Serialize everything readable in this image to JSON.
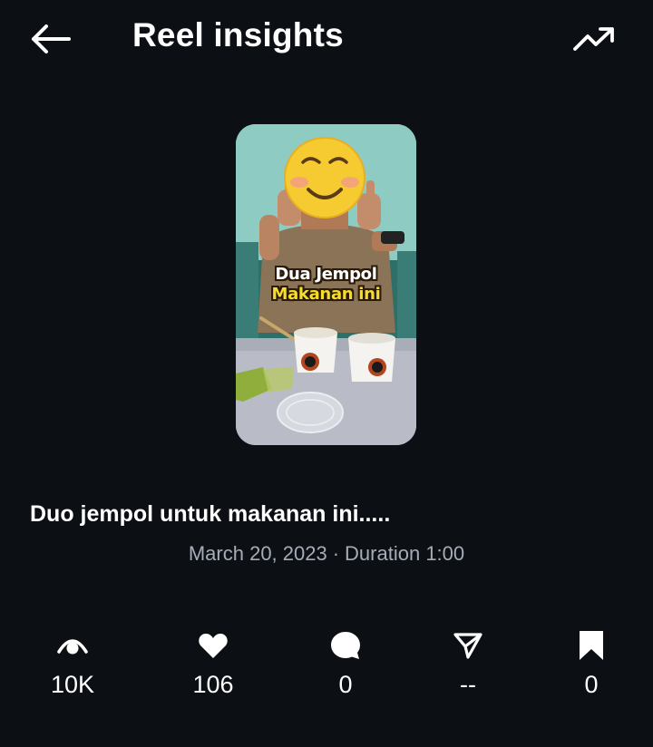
{
  "header": {
    "title": "Reel insights",
    "back_icon": "back-arrow-icon",
    "trend_icon": "trending-up-icon"
  },
  "reel": {
    "overlay_line1": "Dua Jempol",
    "overlay_line2": "Makanan ini",
    "caption": "Duo jempol untuk makanan ini.....",
    "date": "March 20, 2023",
    "separator": "·",
    "duration": "Duration 1:00"
  },
  "stats": [
    {
      "icon": "eye-icon",
      "value": "10K"
    },
    {
      "icon": "heart-icon",
      "value": "106"
    },
    {
      "icon": "comment-icon",
      "value": "0"
    },
    {
      "icon": "share-icon",
      "value": "--"
    },
    {
      "icon": "bookmark-icon",
      "value": "0"
    }
  ],
  "colors": {
    "background": "#0c0f14",
    "text": "#ffffff",
    "muted": "#a5adb8",
    "overlay_yellow": "#f6dd2a"
  }
}
